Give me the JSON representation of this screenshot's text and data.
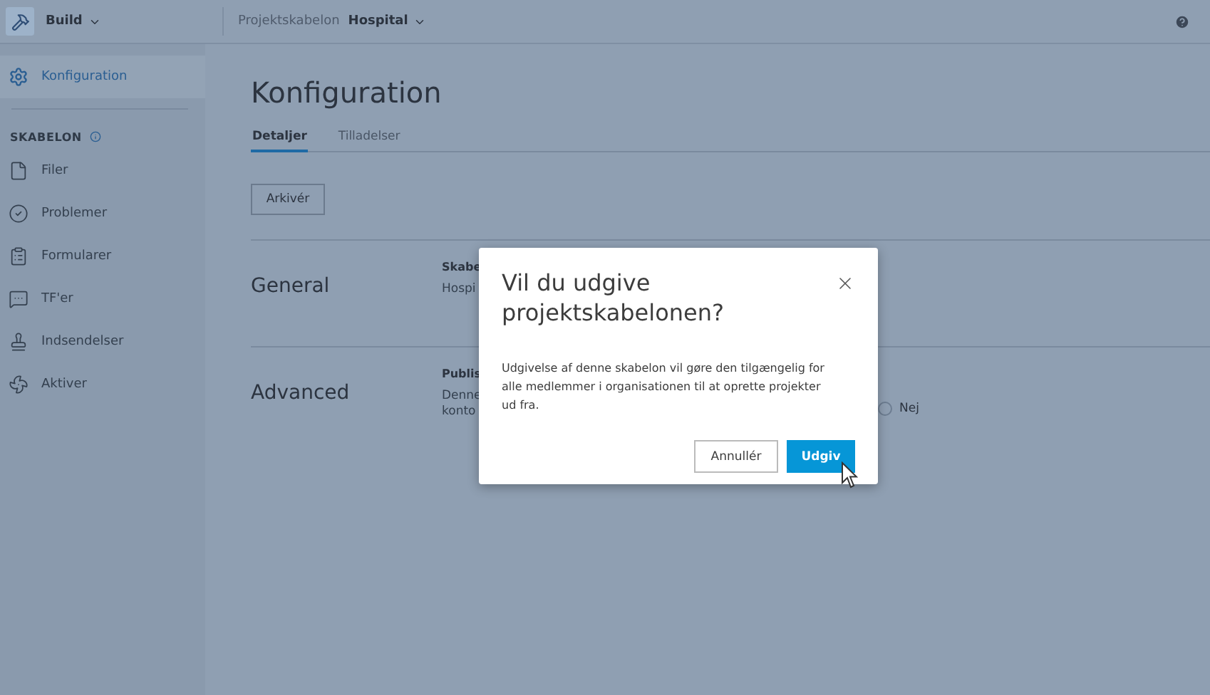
{
  "topbar": {
    "product": "Build",
    "breadcrumb_label": "Projektskabelon",
    "breadcrumb_value": "Hospital"
  },
  "sidebar": {
    "top_item": {
      "label": "Konfiguration",
      "selected": true
    },
    "section": "SKABELON",
    "items": [
      {
        "label": "Filer",
        "kind": "file",
        "selected": false
      },
      {
        "label": "Problemer",
        "kind": "check",
        "selected": false
      },
      {
        "label": "Formularer",
        "kind": "clipboard",
        "selected": false
      },
      {
        "label": "TF'er",
        "kind": "message",
        "selected": false
      },
      {
        "label": "Indsendelser",
        "kind": "stamp",
        "selected": false
      },
      {
        "label": "Aktiver",
        "kind": "fan",
        "selected": false
      }
    ]
  },
  "page": {
    "title": "Konfiguration",
    "tabs": [
      {
        "label": "Detaljer",
        "selected": true
      },
      {
        "label": "Tilladelser",
        "selected": false
      }
    ],
    "archive_button": "Arkivér",
    "sections": [
      {
        "heading": "General",
        "field_label": "Skabe",
        "lines": [
          "Hospi"
        ]
      },
      {
        "heading": "Advanced",
        "field_label": "Publis",
        "lines": [
          "Denne",
          "konto"
        ],
        "options": [
          {
            "label": "Nej",
            "selected": false
          }
        ]
      }
    ]
  },
  "dialog": {
    "title": "Vil du udgive projektskabelonen?",
    "body": "Udgivelse af denne skabelon vil gøre den tilgængelig for alle medlemmer i organisationen til at oprette projekter ud fra.",
    "buttons": [
      {
        "label": "Annullér",
        "kind": "secondary"
      },
      {
        "label": "Udgiv",
        "kind": "primary"
      }
    ]
  }
}
